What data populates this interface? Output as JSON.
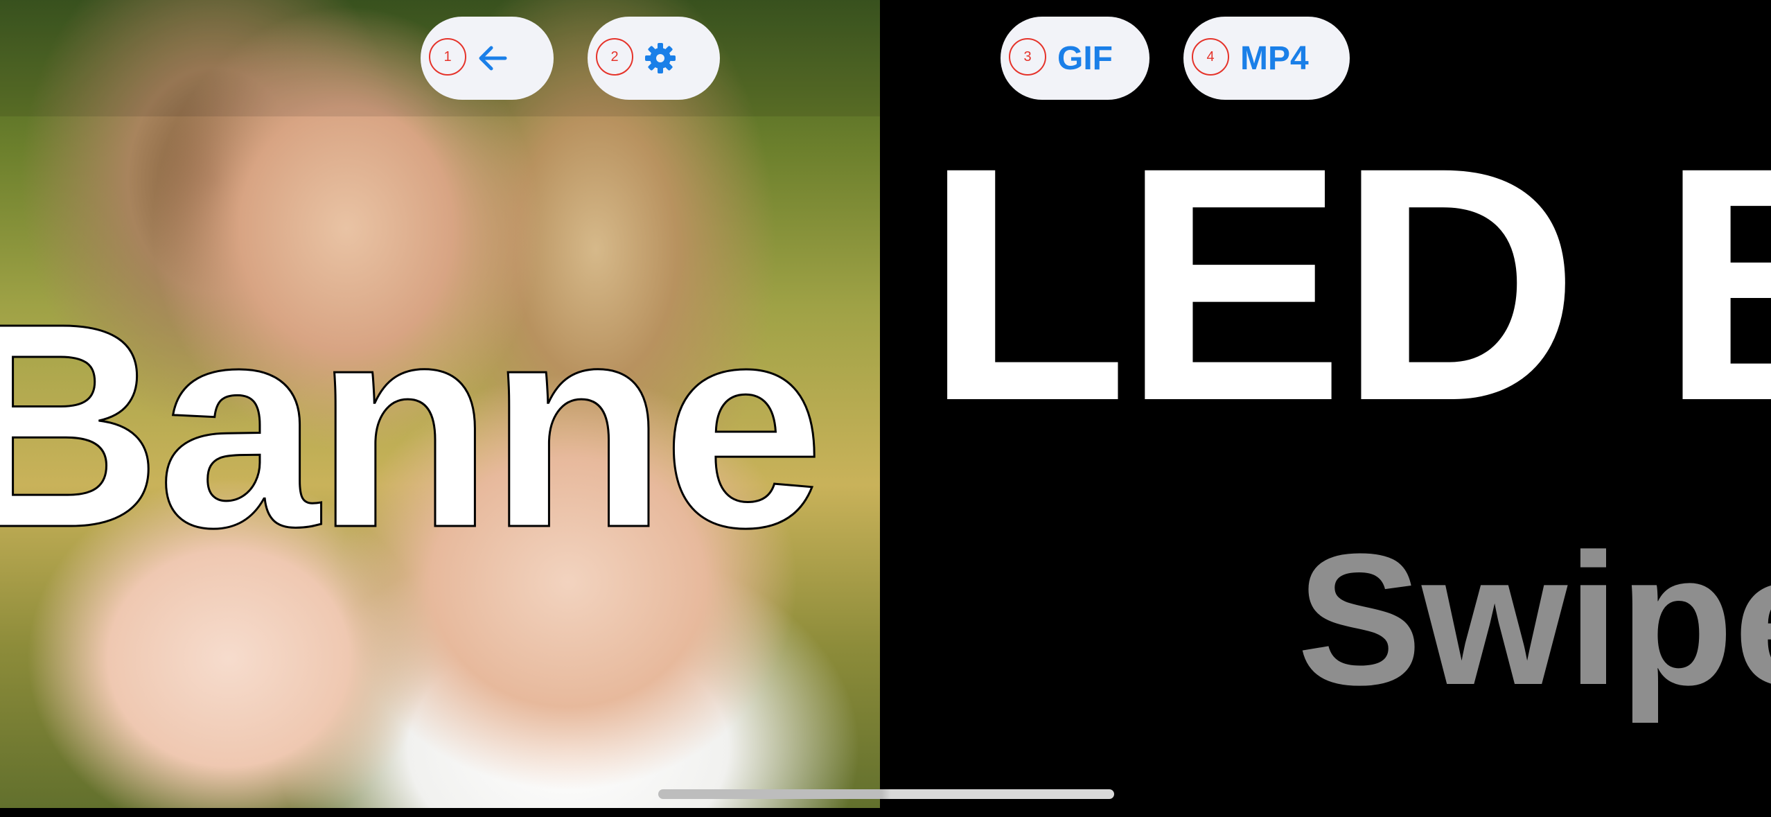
{
  "scene": {
    "banner_text": "Banne",
    "led_text": "LED B",
    "swipe_text": "Swipe"
  },
  "toolbar": {
    "buttons": [
      {
        "badge": "1",
        "icon": "arrow-left-icon",
        "label": ""
      },
      {
        "badge": "2",
        "icon": "gear-icon",
        "label": ""
      },
      {
        "badge": "3",
        "icon": "",
        "label": "GIF"
      },
      {
        "badge": "4",
        "icon": "",
        "label": "MP4"
      }
    ]
  },
  "colors": {
    "accent": "#1a7fe8",
    "badge": "#e5332a",
    "pill_background": "#f2f3f8",
    "swipe_text": "#8e8e8e",
    "background": "#000000"
  }
}
